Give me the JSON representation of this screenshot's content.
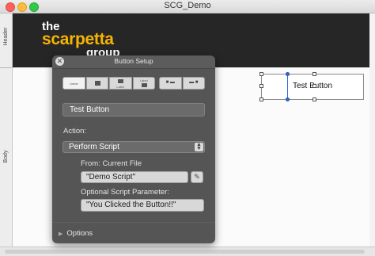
{
  "window": {
    "title": "SCG_Demo"
  },
  "parts": {
    "header_label": "Header",
    "body_label": "Body"
  },
  "logo": {
    "line1": "the",
    "line2": "scarpetta",
    "line3": "group",
    "accent_color": "#f7b500"
  },
  "layout": {
    "button_label": "Test Button"
  },
  "panel": {
    "title": "Button Setup",
    "close_glyph": "✕",
    "style_buttons": [
      {
        "name": "style-linear",
        "label": "Linear"
      },
      {
        "name": "style-square",
        "label": ""
      },
      {
        "name": "style-label-below",
        "label": "Label"
      },
      {
        "name": "style-label-above",
        "label": "Label"
      },
      {
        "name": "style-icon-left",
        "label": ""
      },
      {
        "name": "style-icon-right",
        "label": ""
      }
    ],
    "button_name": "Test Button",
    "action_label": "Action:",
    "action_value": "Perform Script",
    "from_label": "From: Current File",
    "script_value": "\"Demo Script\"",
    "param_label": "Optional Script Parameter:",
    "param_value": "\"You Clicked the Button!!\"",
    "options_label": "Options"
  },
  "colors": {
    "panel_bg": "#4e4e4e",
    "header_bg": "#262626",
    "selection_blue": "#2e6bd6"
  }
}
